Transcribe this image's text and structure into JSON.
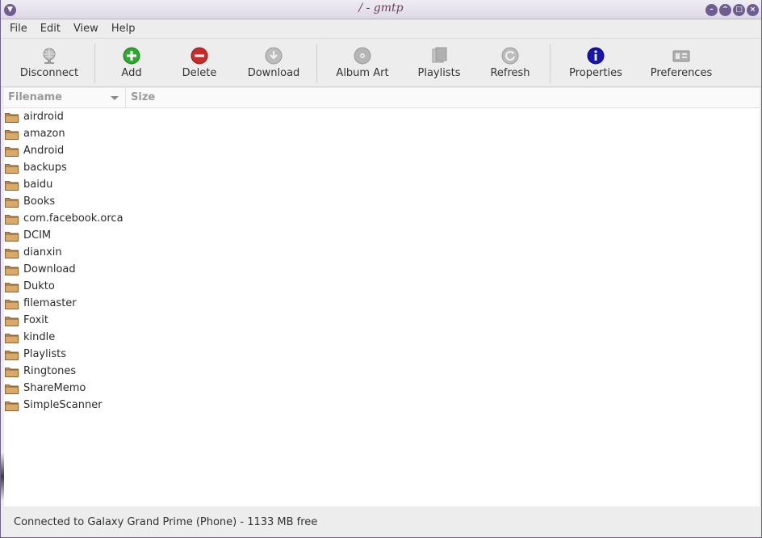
{
  "window": {
    "title": "/ - gmtp"
  },
  "menubar": {
    "items": [
      "File",
      "Edit",
      "View",
      "Help"
    ]
  },
  "toolbar": {
    "disconnect": "Disconnect",
    "add": "Add",
    "delete": "Delete",
    "download": "Download",
    "album_art": "Album Art",
    "playlists": "Playlists",
    "refresh": "Refresh",
    "properties": "Properties",
    "preferences": "Preferences"
  },
  "list": {
    "columns": [
      "Filename",
      "Size"
    ],
    "rows": [
      "airdroid",
      "amazon",
      "Android",
      "backups",
      "baidu",
      "Books",
      "com.facebook.orca",
      "DCIM",
      "dianxin",
      "Download",
      "Dukto",
      "filemaster",
      "Foxit",
      "kindle",
      "Playlists",
      "Ringtones",
      "ShareMemo",
      "SimpleScanner"
    ]
  },
  "status": {
    "text": "Connected to Galaxy Grand Prime (Phone) - 1133 MB free"
  },
  "colors": {
    "accent": "#6f5d91",
    "folder": "#c9965a"
  }
}
